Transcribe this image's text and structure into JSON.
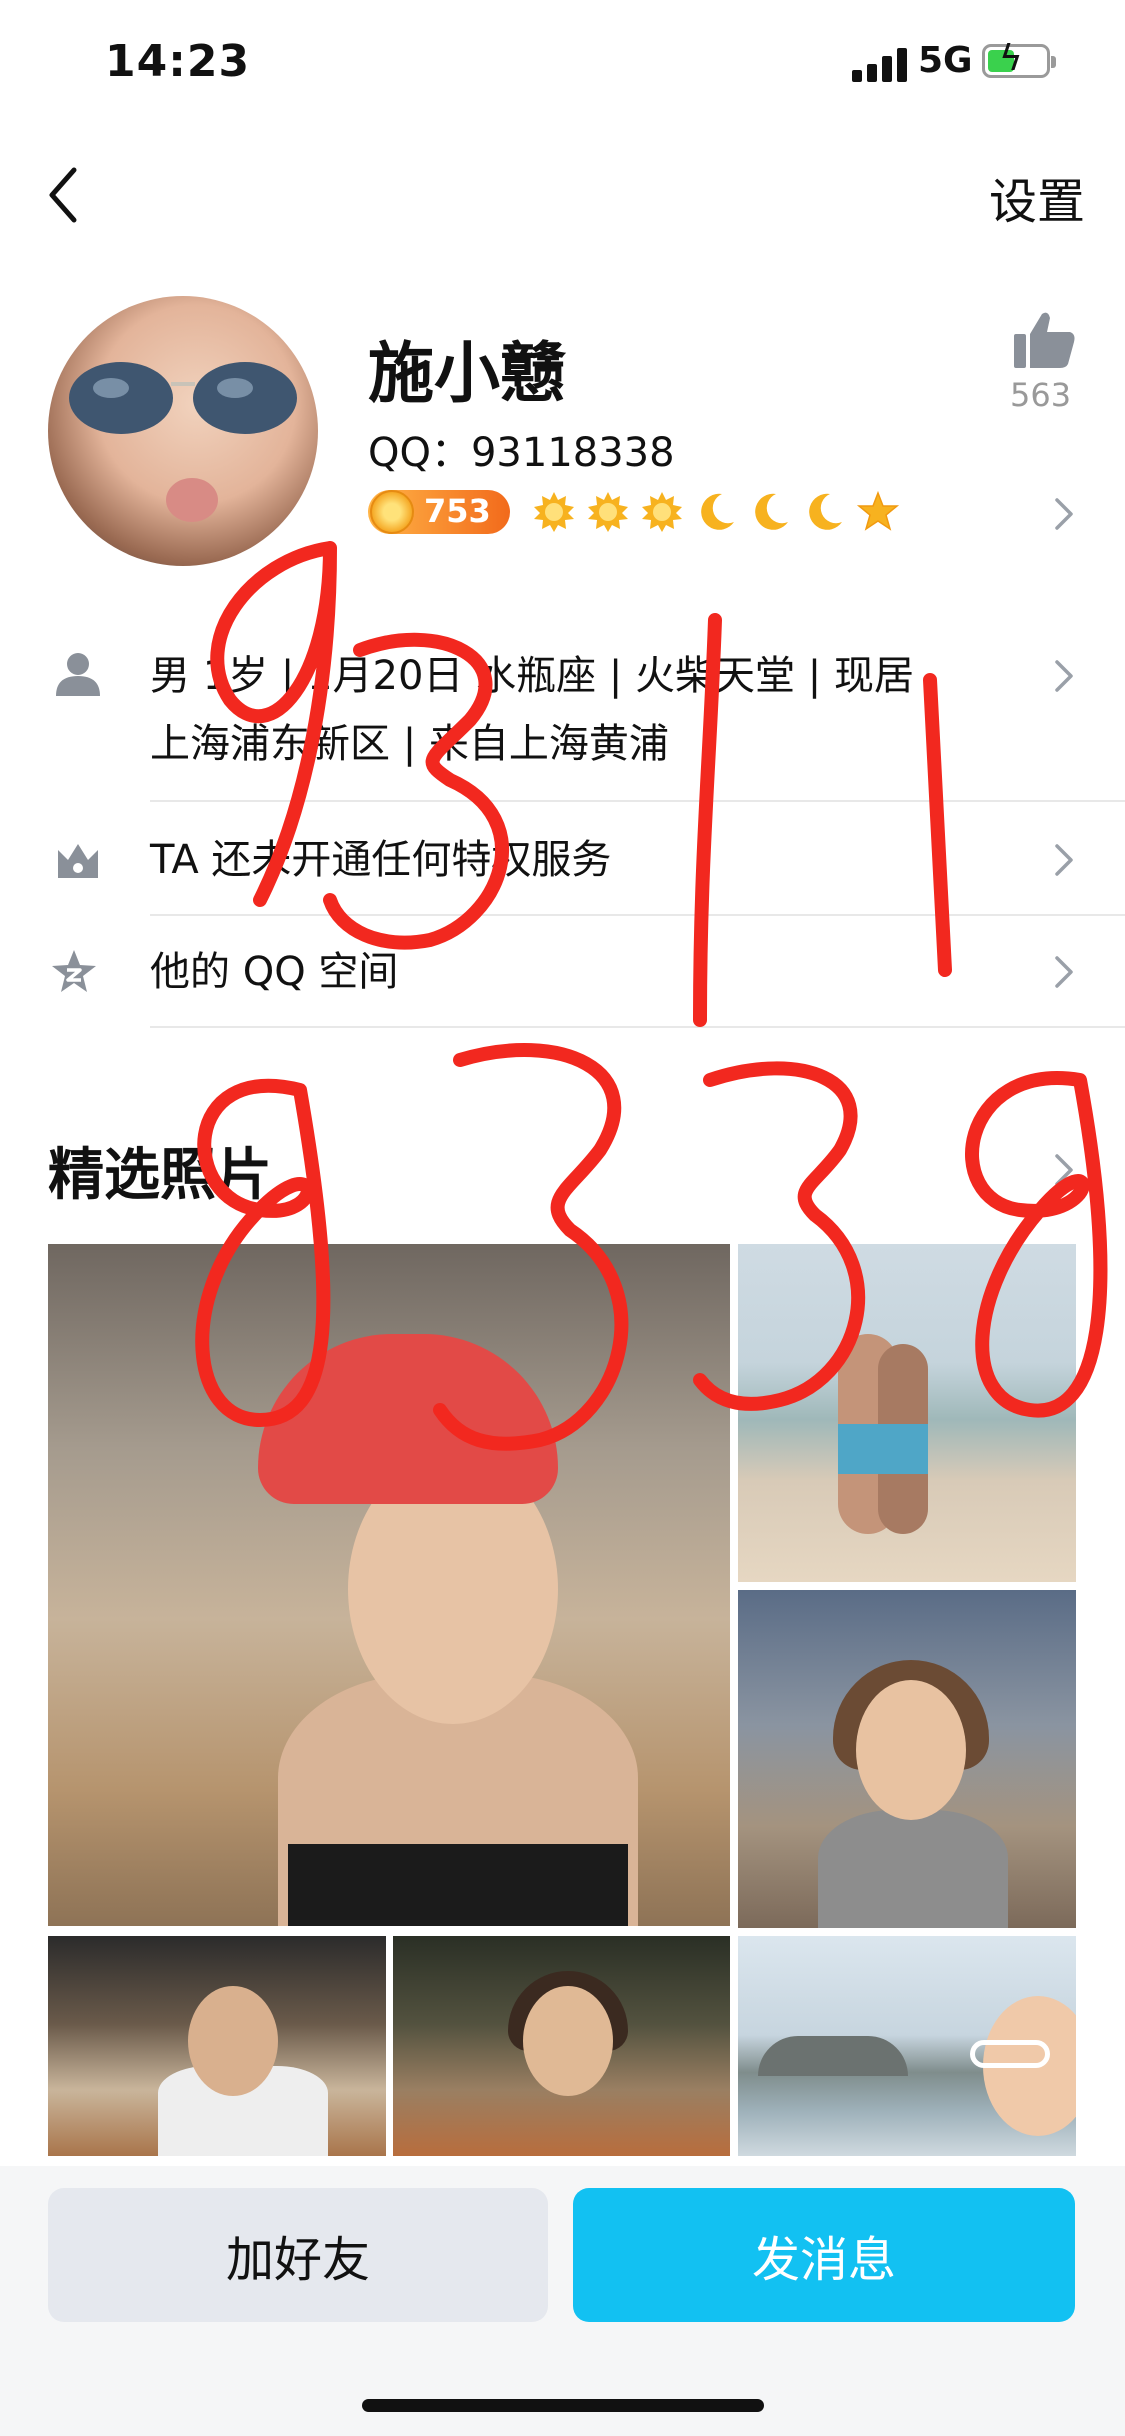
{
  "status_bar": {
    "time": "14:23",
    "network": "5G"
  },
  "nav": {
    "settings_label": "设置"
  },
  "profile": {
    "name": "施小戆",
    "qq_label": "QQ：93118338",
    "likes": "563",
    "level": "753"
  },
  "info": {
    "line1": "男 1岁 | 1月20日 水瓶座 | 火柴天堂 | 现居",
    "line2": "上海浦东新区 | 来自上海黄浦",
    "privilege": "TA 还未开通任何特权服务",
    "qzone": "他的 QQ 空间"
  },
  "photos": {
    "title": "精选照片"
  },
  "handwriting": [
    "9311",
    "8338"
  ],
  "actions": {
    "add_friend": "加好友",
    "send_message": "发消息"
  },
  "colors": {
    "accent": "#12c1f2",
    "scribble": "#f2281f",
    "icon_gray": "#8a9099"
  },
  "icons": [
    "back-chevron-icon",
    "thumbs-up-icon",
    "coin-icon",
    "sun-icon",
    "moon-icon",
    "star-icon",
    "person-icon",
    "crown-icon",
    "qzone-star-icon",
    "chevron-right-icon"
  ]
}
